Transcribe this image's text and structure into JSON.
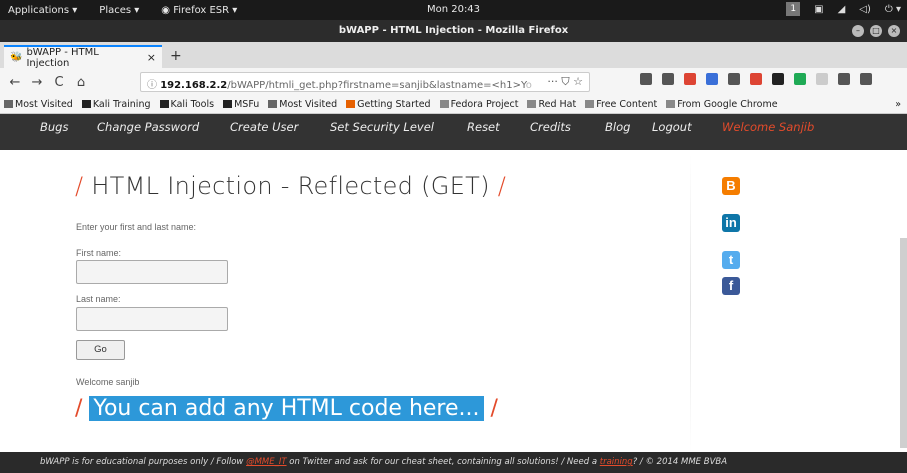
{
  "gnome": {
    "applications": "Applications ▾",
    "places": "Places ▾",
    "firefox": "Firefox ESR ▾",
    "clock": "Mon 20:43",
    "workspace": "1"
  },
  "window": {
    "title": "bWAPP - HTML Injection - Mozilla Firefox"
  },
  "tab": {
    "label": "bWAPP - HTML Injection",
    "close": "×",
    "new": "+"
  },
  "nav": {
    "back": "←",
    "forward": "→",
    "reload": "C",
    "home": "⌂",
    "url_host": "192.168.2.2",
    "url_path": "/bWAPP/htmli_get.php?firstname=sanjib&lastname=<h1>Y",
    "url_fade": "o",
    "more": "···",
    "star": "☆",
    "icon_colors": [
      "#555",
      "#555",
      "#d43",
      "#3a6fd8",
      "#555",
      "#d43",
      "#222",
      "#1faa55",
      "#ccc",
      "#555",
      "#555"
    ]
  },
  "bookmarks": [
    {
      "label": "Most Visited",
      "icon": "gear-icon",
      "color": "#666"
    },
    {
      "label": "Kali Training",
      "icon": "kali-icon",
      "color": "#222"
    },
    {
      "label": "Kali Tools",
      "icon": "kali-icon",
      "color": "#222"
    },
    {
      "label": "MSFu",
      "icon": "msf-icon",
      "color": "#222"
    },
    {
      "label": "Most Visited",
      "icon": "gear-icon",
      "color": "#666"
    },
    {
      "label": "Getting Started",
      "icon": "firefox-icon",
      "color": "#e66000"
    },
    {
      "label": "Fedora Project",
      "icon": "folder-icon",
      "color": "#888"
    },
    {
      "label": "Red Hat",
      "icon": "folder-icon",
      "color": "#888"
    },
    {
      "label": "Free Content",
      "icon": "folder-icon",
      "color": "#888"
    },
    {
      "label": "From Google Chrome",
      "icon": "folder-icon",
      "color": "#888"
    }
  ],
  "bookmarks_overflow": "»",
  "topnav": {
    "items": [
      "Bugs",
      "Change Password",
      "Create User",
      "Set Security Level",
      "Reset",
      "Credits",
      "Blog",
      "Logout"
    ],
    "welcome": "Welcome Sanjib"
  },
  "page": {
    "heading_slash_left": "/",
    "heading": "HTML Injection - Reflected (GET)",
    "heading_slash_right": "/",
    "intro": "Enter your first and last name:",
    "first_label": "First name:",
    "last_label": "Last name:",
    "go": "Go",
    "welcome_msg": "Welcome sanjib",
    "inj_slash_left": "/",
    "inj_text": "You can add any HTML code here...",
    "inj_slash_right": "/"
  },
  "social": [
    {
      "glyph": "B",
      "color": "#f57d00",
      "name": "blogger-icon"
    },
    {
      "glyph": "in",
      "color": "#0e76a8",
      "name": "linkedin-icon"
    },
    {
      "glyph": "t",
      "color": "#55acee",
      "name": "twitter-icon"
    },
    {
      "glyph": "f",
      "color": "#3b5998",
      "name": "facebook-icon"
    }
  ],
  "footer": {
    "part1": "bWAPP is for educational purposes only / Follow",
    "link1": "@MME_IT",
    "part2": "on Twitter and ask for our cheat sheet, containing all solutions! / Need a",
    "link2": "training",
    "part3": "? / © 2014 MME BVBA"
  }
}
